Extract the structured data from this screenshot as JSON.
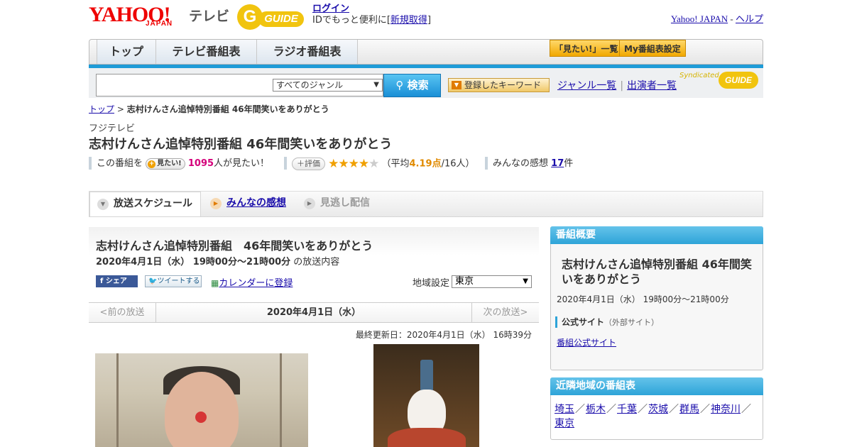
{
  "header": {
    "logo_yahoo": "YAHOO!",
    "logo_japan": "JAPAN",
    "logo_tv": "テレビ",
    "gguide_g": "G",
    "gguide_text": "GUIDE",
    "login_link": "ログイン",
    "login_prefix": "IDでもっと便利に[",
    "register_link": "新規取得",
    "login_suffix": "]",
    "yahoo_japan_link": "Yahoo! JAPAN",
    "sep": " - ",
    "help_link": "ヘルプ"
  },
  "nav": {
    "tabs": [
      {
        "label": "トップ"
      },
      {
        "label": "テレビ番組表"
      },
      {
        "label": "ラジオ番組表"
      }
    ],
    "mitai_list": "「見たい!」一覧",
    "my_schedule": "My番組表設定"
  },
  "search": {
    "placeholder": "",
    "genre_selected": "すべてのジャンル",
    "search_button": "検索",
    "keyword_button": "登録したキーワード",
    "genre_list_link": "ジャンル一覧",
    "cast_list_link": "出演者一覧",
    "syndicated": "Syndicated",
    "syn_logo": "GUIDE"
  },
  "breadcrumb": {
    "top": "トップ",
    "sep": " > ",
    "current": "志村けんさん追悼特別番組 46年間笑いをありがとう"
  },
  "program": {
    "station": "フジテレビ",
    "title": "志村けんさん追悼特別番組 46年間笑いをありがとう",
    "stats": {
      "prefix": "この番組を",
      "mitai_button": "見たい!",
      "mitai_count": "1095",
      "mitai_suffix": "人が見たい！",
      "rate_button": "評価",
      "stars_rating": 4.19,
      "stars_filled": "★★★★",
      "stars_empty": "★",
      "avg_open": "（平均",
      "avg_value": "4.19点",
      "avg_count": "/16人）",
      "impressions_label": "みんなの感想",
      "impressions_count": "17",
      "impressions_suffix": "件"
    }
  },
  "tabs": [
    {
      "label": "放送スケジュール",
      "state": "active"
    },
    {
      "label": "みんなの感想",
      "state": "link"
    },
    {
      "label": "見逃し配信",
      "state": "disabled"
    }
  ],
  "schedule": {
    "title": "志村けんさん追悼特別番組　46年間笑いをありがとう",
    "datetime": "2020年4月1日（水）  19時00分～21時00分",
    "datetime_suffix": " の放送内容",
    "facebook_share": "シェア",
    "tweet": "ツイートする",
    "calendar_link": "カレンダーに登録",
    "region_label": "地域設定",
    "region_selected": "東京",
    "prev": "<前の放送",
    "current_date": "2020年4月1日（水）",
    "next": "次の放送>",
    "updated": "最終更新日：2020年4月1日（水）  16時39分"
  },
  "overview": {
    "header": "番組概要",
    "title": "志村けんさん追悼特別番組 46年間笑いをありがとう",
    "time": "2020年4月1日（水）  19時00分～21時00分",
    "official_label": "公式サイト",
    "official_sub": "（外部サイト）",
    "official_link": "番組公式サイト"
  },
  "nearby": {
    "header": "近隣地域の番組表",
    "areas": [
      "埼玉",
      "栃木",
      "千葉",
      "茨城",
      "群馬",
      "神奈川",
      "東京"
    ],
    "sep": "／"
  }
}
